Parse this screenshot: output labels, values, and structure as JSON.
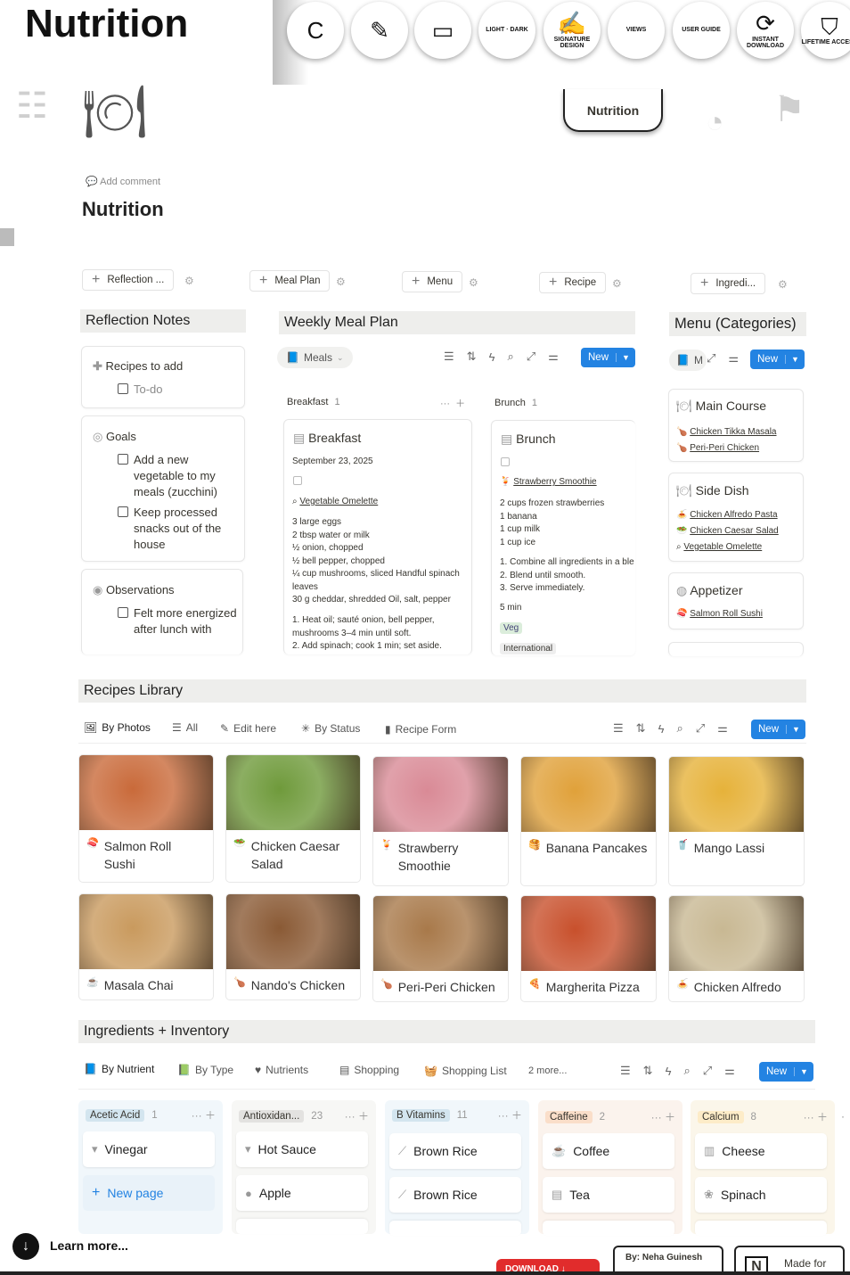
{
  "header": {
    "big_title": "Nutrition",
    "circles": [
      {
        "name": "logo-circle",
        "glyph": "C",
        "text": ""
      },
      {
        "name": "icon-circle",
        "glyph": "✎",
        "text": ""
      },
      {
        "name": "devices-circle",
        "glyph": "▭",
        "text": ""
      },
      {
        "name": "theme-circle",
        "glyph": "",
        "text": "LIGHT · DARK"
      },
      {
        "name": "signature-design-circle",
        "glyph": "✍",
        "text": "SIGNATURE DESIGN"
      },
      {
        "name": "views-circle",
        "glyph": "",
        "text": "VIEWS"
      },
      {
        "name": "user-guide-circle",
        "glyph": "",
        "text": "USER GUIDE"
      },
      {
        "name": "instant-download-circle",
        "glyph": "⟳",
        "text": "INSTANT DOWNLOAD"
      },
      {
        "name": "lifetime-access-circle",
        "glyph": "⛉",
        "text": "LIFETIME ACCESS"
      }
    ],
    "tab_note": "Nutrition",
    "add_comment": "Add comment",
    "page_title": "Nutrition"
  },
  "buttons": [
    "Reflection ...",
    "Meal Plan",
    "Menu",
    "Recipe",
    "Ingredi..."
  ],
  "reflection": {
    "title": "Reflection Notes",
    "recipes_title": "Recipes to add",
    "recipes_todo": "To-do",
    "goals_title": "Goals",
    "goal_1": "Add a new vegetable to my meals (zucchini)",
    "goal_2": "Keep processed snacks out of the house",
    "obs_title": "Observations",
    "obs_1": "Felt more energized after lunch with"
  },
  "meal_plan": {
    "title": "Weekly Meal Plan",
    "view": "Meals",
    "new": "New",
    "col1": {
      "name": "Breakfast",
      "count": "1"
    },
    "col2": {
      "name": "Brunch",
      "count": "1"
    },
    "card1": {
      "title": "Breakfast",
      "date": "September 23, 2025",
      "recipe": "Vegetable Omelette",
      "ingredients": "3 large eggs\n2 tbsp water or milk\n½ onion, chopped\n½ bell pepper, chopped\n¼ cup mushrooms, sliced  Handful spinach leaves\n30 g cheddar, shredded  Oil, salt, pepper",
      "steps": "1. Heat oil; sauté onion, bell pepper, mushrooms 3–4 min until soft.\n2. Add spinach; cook 1 min; set aside."
    },
    "card2": {
      "title": "Brunch",
      "recipe": "Strawberry Smoothie",
      "ingredients": "2 cups frozen strawberries\n1 banana\n1 cup milk\n1 cup ice",
      "steps": "1. Combine all ingredients in a ble\n2. Blend until smooth.\n3. Serve immediately.",
      "time": "5 min",
      "tag1": "Veg",
      "tag2": "International"
    }
  },
  "menu": {
    "title": "Menu (Categories)",
    "view": "M",
    "new": "New",
    "groups": [
      {
        "title": "Main Course",
        "items": [
          "Chicken Tikka Masala",
          "Peri-Peri Chicken"
        ]
      },
      {
        "title": "Side Dish",
        "items": [
          "Chicken Alfredo Pasta",
          "Chicken Caesar Salad",
          "Vegetable Omelette"
        ]
      },
      {
        "title": "Appetizer",
        "items": [
          "Salmon Roll Sushi"
        ]
      }
    ]
  },
  "library": {
    "title": "Recipes Library",
    "tabs": [
      "By Photos",
      "All",
      "Edit here",
      "By Status",
      "Recipe Form"
    ],
    "new": "New",
    "recipes": [
      "Salmon Roll Sushi",
      "Chicken Caesar Salad",
      "Strawberry Smoothie",
      "Banana Pancakes",
      "Mango Lassi",
      "Masala Chai",
      "Nando's Chicken",
      "Peri-Peri Chicken",
      "Margherita Pizza",
      "Chicken Alfredo"
    ],
    "photo_colors": [
      "#c96a3a",
      "#6f9a3b",
      "#d98a96",
      "#e0a13a",
      "#e6b23a",
      "#c99a5e",
      "#8a5a35",
      "#a8794a",
      "#c8502c",
      "#c8b893"
    ]
  },
  "ingredients": {
    "title": "Ingredients + Inventory",
    "tabs": [
      "By Nutrient",
      "By Type",
      "Nutrients",
      "Shopping",
      "Shopping List",
      "2 more..."
    ],
    "new": "New",
    "columns": [
      {
        "name": "Acetic Acid",
        "count": "1",
        "color": "#d3e5ef",
        "bg": "#f1f7fb",
        "cards": [
          "Vinegar"
        ],
        "extra": "New page"
      },
      {
        "name": "Antioxidan...",
        "count": "23",
        "color": "#e3e2e0",
        "bg": "#f7f7f5",
        "cards": [
          "Hot Sauce",
          "Apple"
        ]
      },
      {
        "name": "B Vitamins",
        "count": "11",
        "color": "#d3e5ef",
        "bg": "#f1f7fb",
        "cards": [
          "Brown Rice",
          "Brown Rice"
        ]
      },
      {
        "name": "Caffeine",
        "count": "2",
        "color": "#fadec9",
        "bg": "#fbf3ed",
        "cards": [
          "Coffee",
          "Tea"
        ]
      },
      {
        "name": "Calcium",
        "count": "8",
        "color": "#fdecc8",
        "bg": "#fbf6ea",
        "cards": [
          "Cheese",
          "Spinach"
        ]
      }
    ]
  },
  "footer": {
    "learn_more": "Learn more...",
    "download": "DOWNLOAD",
    "by": "By: Neha Guinesh",
    "made_for": "Made for"
  }
}
